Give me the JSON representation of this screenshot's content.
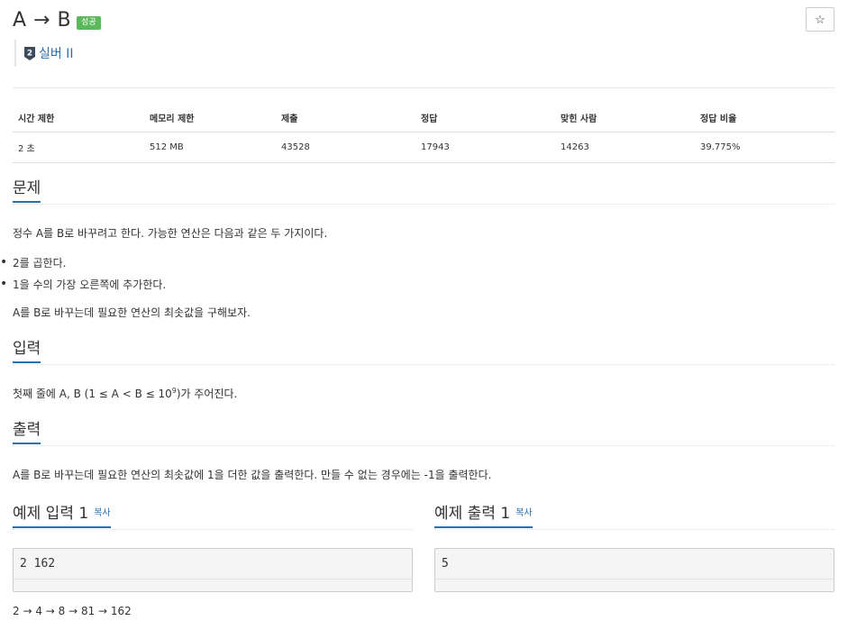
{
  "problem": {
    "title": "A → B",
    "status_badge": "성공",
    "star_icon": "☆",
    "tier_number": "2",
    "tier_label": "실버 II"
  },
  "info_table": {
    "headers": [
      "시간 제한",
      "메모리 제한",
      "제출",
      "정답",
      "맞힌 사람",
      "정답 비율"
    ],
    "values": [
      "2 초",
      "512 MB",
      "43528",
      "17943",
      "14263",
      "39.775%"
    ]
  },
  "sections": {
    "problem_title": "문제",
    "problem_desc": "정수 A를 B로 바꾸려고 한다. 가능한 연산은 다음과 같은 두 가지이다.",
    "operations": [
      "2를 곱한다.",
      "1을 수의 가장 오른쪽에 추가한다."
    ],
    "problem_goal": "A를 B로 바꾸는데 필요한 연산의 최솟값을 구해보자.",
    "input_title": "입력",
    "input_desc_before": "첫째 줄에 A, B (1 ≤ A < B ≤ 10",
    "input_desc_sup": "9",
    "input_desc_after": ")가 주어진다.",
    "output_title": "출력",
    "output_desc": "A를 B로 바꾸는데 필요한 연산의 최솟값에 1을 더한 값을 출력한다. 만들 수 없는 경우에는 -1을 출력한다."
  },
  "samples": {
    "input_title": "예제 입력 1",
    "output_title": "예제 출력 1",
    "copy_label": "복사",
    "input_value": "2 162",
    "output_value": "5",
    "explanation": "2 → 4 → 8 → 81 → 162"
  }
}
